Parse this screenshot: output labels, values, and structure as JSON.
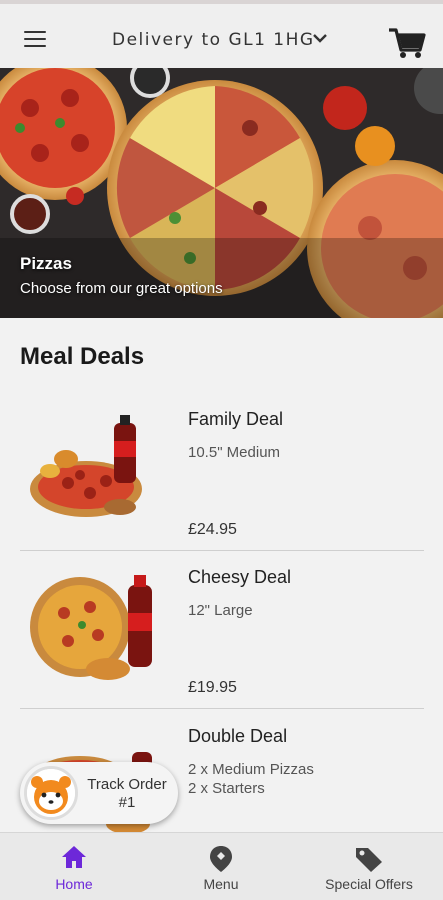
{
  "header": {
    "delivery_text": "Delivery to GL1 1HG",
    "menu_icon": "hamburger-icon",
    "dropdown_icon": "chevron-down-icon",
    "cart_icon": "cart-icon"
  },
  "hero": {
    "title": "Pizzas",
    "subtitle": "Choose from our great options"
  },
  "section": {
    "title": "Meal Deals"
  },
  "deals": [
    {
      "name": "Family Deal",
      "desc": "10.5\" Medium",
      "price": "£24.95"
    },
    {
      "name": "Cheesy Deal",
      "desc": "12\" Large",
      "price": "£19.95"
    },
    {
      "name": "Double Deal",
      "desc_line1": "2 x Medium Pizzas",
      "desc_line2": "2 x Starters"
    }
  ],
  "track_order": {
    "line1": "Track Order",
    "line2": "#1"
  },
  "bottom_nav": {
    "items": [
      {
        "label": "Home",
        "icon": "home-icon",
        "active": true
      },
      {
        "label": "Menu",
        "icon": "location-pin-icon",
        "active": false
      },
      {
        "label": "Special Offers",
        "icon": "tag-icon",
        "active": false
      }
    ]
  },
  "colors": {
    "accent": "#6d28d9",
    "topbar": "#efefef",
    "background": "#f2f2f2"
  }
}
